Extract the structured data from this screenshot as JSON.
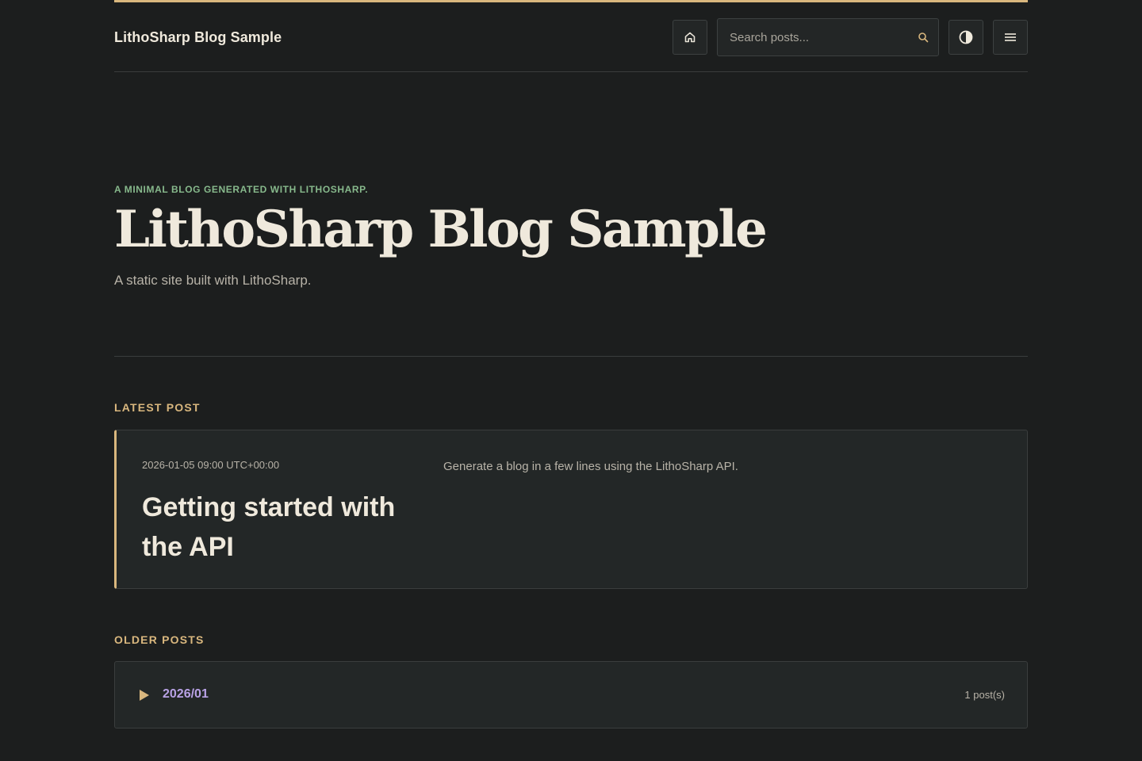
{
  "header": {
    "brand": "LithoSharp Blog Sample",
    "search_placeholder": "Search posts...",
    "home_icon": "home-icon",
    "theme_icon": "contrast-icon",
    "menu_icon": "menu-icon",
    "search_icon": "search-icon"
  },
  "hero": {
    "eyebrow": "A minimal blog generated with LithoSharp.",
    "title": "LithoSharp Blog Sample",
    "subtitle": "A static site built with LithoSharp."
  },
  "latest": {
    "label": "Latest Post",
    "post": {
      "date": "2026-01-05 09:00 UTC+00:00",
      "title": "Getting started with the API",
      "summary": "Generate a blog in a few lines using the LithoSharp API."
    }
  },
  "older": {
    "label": "Older Posts",
    "groups": [
      {
        "month": "2026/01",
        "count": "1 post(s)"
      }
    ]
  },
  "colors": {
    "background": "#1c1e1e",
    "accent": "#d9b77e",
    "eyebrow": "#87b98c",
    "link": "#b9a2e6",
    "card": "#232727"
  }
}
